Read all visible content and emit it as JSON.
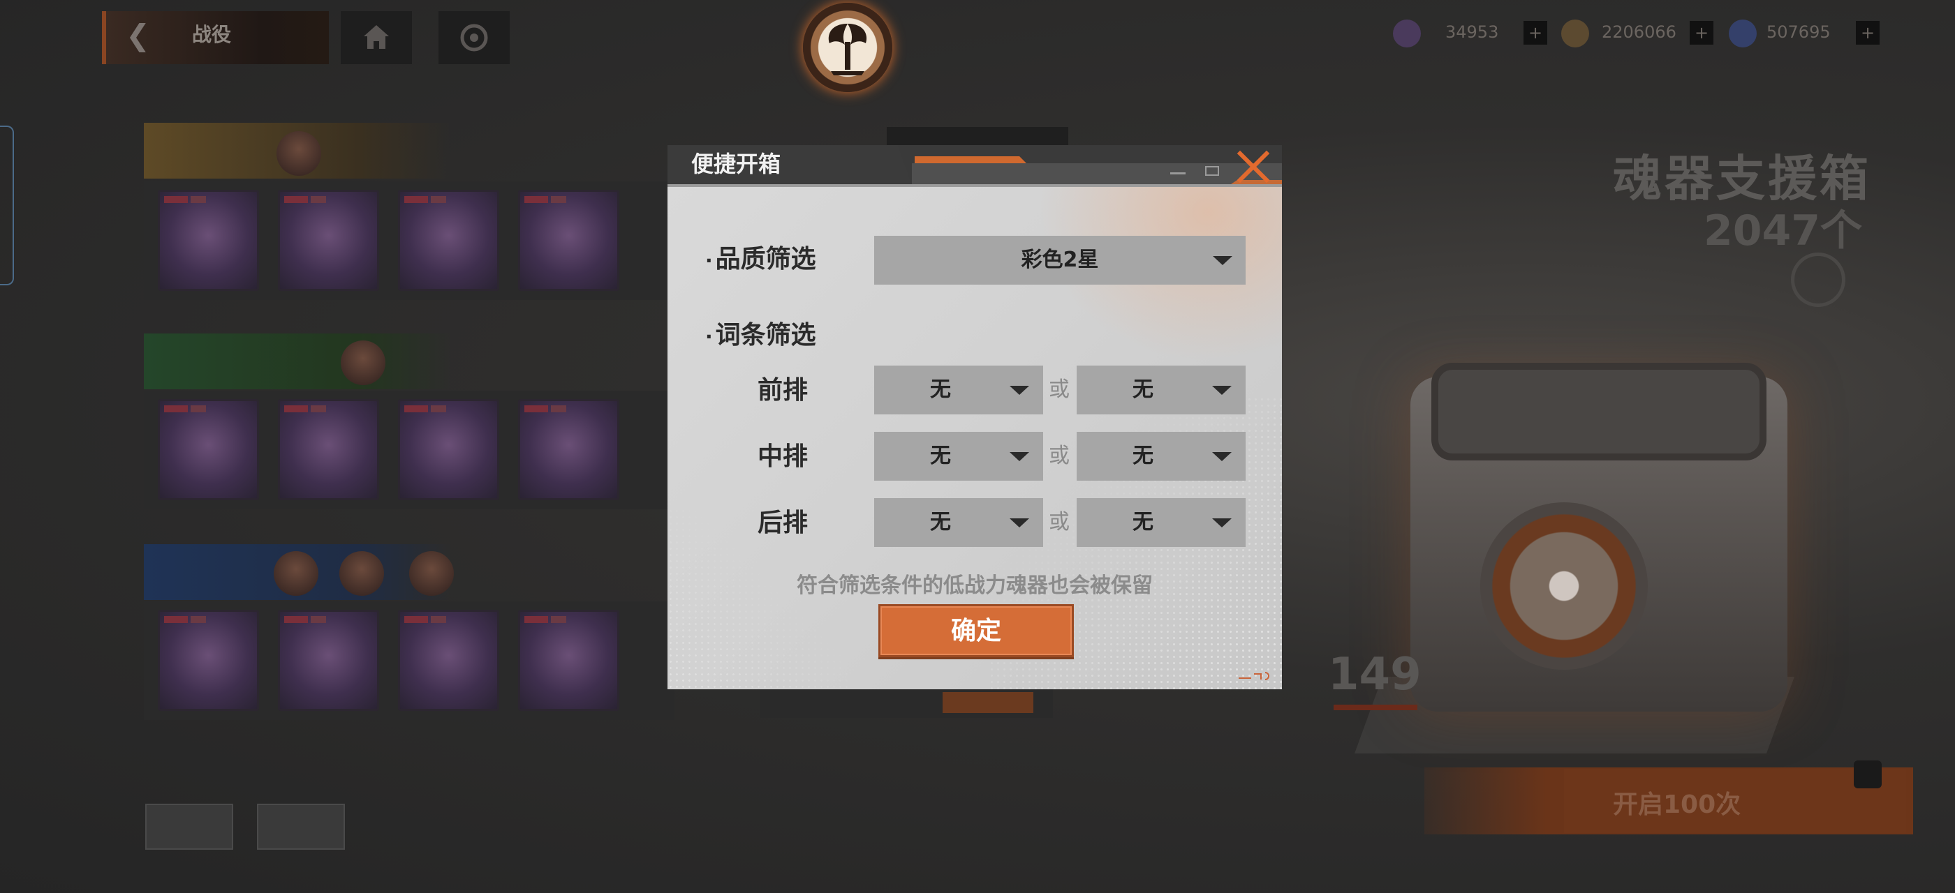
{
  "background": {
    "top_bar": {
      "back_title": "战役",
      "back_subtitle": ""
    },
    "currencies": [
      {
        "icon": "gem-icon",
        "value": "34953",
        "color": "#6a4d8a"
      },
      {
        "icon": "coin-icon",
        "value": "2206066",
        "color": "#8a6a3a"
      },
      {
        "icon": "ticket-icon",
        "value": "507695",
        "color": "#3a4a7a"
      }
    ],
    "box": {
      "title": "魂器支援箱",
      "count": "2047个",
      "crate_number": "149",
      "open_button_label": "开启100次"
    }
  },
  "dialog": {
    "title": "便捷开箱",
    "quality_filter": {
      "label": "品质筛选",
      "selected": "彩色2星"
    },
    "affix_filter": {
      "label": "词条筛选",
      "or_text": "或",
      "rows": [
        {
          "label": "前排",
          "left": "无",
          "right": "无"
        },
        {
          "label": "中排",
          "left": "无",
          "right": "无"
        },
        {
          "label": "后排",
          "left": "无",
          "right": "无"
        }
      ]
    },
    "note": "符合筛选条件的低战力魂器也会被保留",
    "confirm_label": "确定"
  },
  "colors": {
    "accent": "#d56d37",
    "dropdown_bg": "#a6a6a6",
    "dialog_header": "#3a3a3a"
  }
}
